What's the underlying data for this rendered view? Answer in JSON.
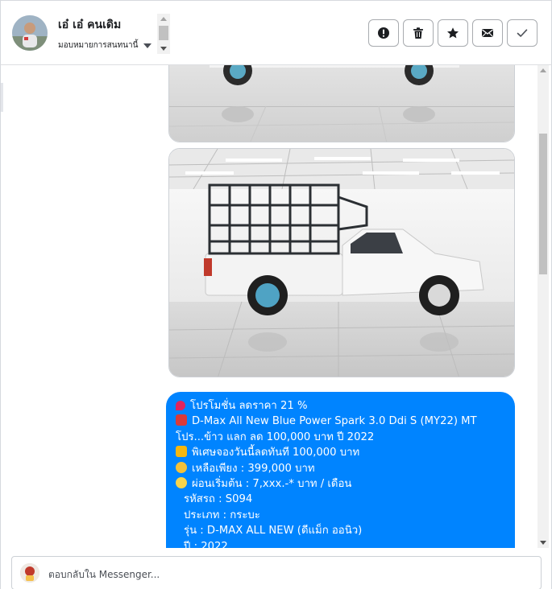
{
  "header": {
    "contact_name": "เอ๋ เอ๋ คนเดิม",
    "assign_label": "มอบหมายการสนทนานี้"
  },
  "actions": [
    {
      "name": "spam-button",
      "icon": "alert-icon"
    },
    {
      "name": "delete-button",
      "icon": "trash-icon"
    },
    {
      "name": "star-button",
      "icon": "star-icon"
    },
    {
      "name": "mark-unread-button",
      "icon": "envelope-icon"
    },
    {
      "name": "done-button",
      "icon": "check-icon"
    }
  ],
  "thread": {
    "images": [
      {
        "name": "car-photo-front",
        "icon": "photo"
      },
      {
        "name": "car-photo-side",
        "icon": "photo"
      }
    ],
    "message_lines": [
      {
        "emoji": "pin",
        "text": "โปรโมชั่น ลดราคา 21 %"
      },
      {
        "emoji": "car",
        "text": "D-Max All New Blue Power Spark 3.0 Ddi S (MY22) MT"
      },
      {
        "emoji": "",
        "text": "โปร...ข้าว แลก ลด 100,000 บาท ปี 2022"
      },
      {
        "emoji": "party",
        "text": "พิเศษจองวันนี้ลดทันที 100,000 บาท"
      },
      {
        "emoji": "point",
        "text": "เหลือเพียง : 399,000 บาท"
      },
      {
        "emoji": "sun",
        "text": "ผ่อนเริ่มต้น : 7,xxx.-* บาท / เดือน"
      },
      {
        "emoji": "",
        "text": "  รหัสรถ : S094"
      },
      {
        "emoji": "",
        "text": "  ประเภท : กระบะ"
      },
      {
        "emoji": "",
        "text": "  รุ่น : D-MAX ALL NEW (ดีแม็ก ออนิว)"
      },
      {
        "emoji": "",
        "text": "  ปี : 2022"
      }
    ]
  },
  "composer": {
    "placeholder": "ตอบกลับใน Messenger..."
  },
  "colors": {
    "bubble": "#0084ff",
    "border": "#ccd0d5"
  }
}
